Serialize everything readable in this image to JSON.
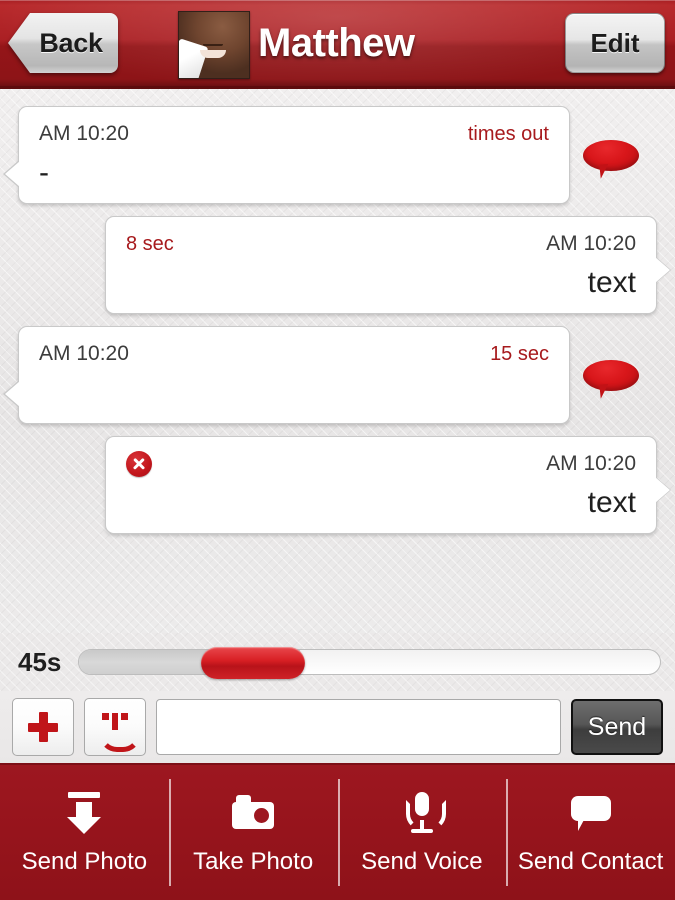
{
  "header": {
    "back_label": "Back",
    "title": "Matthew",
    "edit_label": "Edit",
    "avatar_name": "contact-avatar"
  },
  "colors": {
    "brand_red": "#9d1720",
    "header_red": "#a81f23",
    "status_red": "#a71a1d",
    "accent_red": "#c01519"
  },
  "conversation": {
    "messages": [
      {
        "direction": "incoming",
        "time": "AM 10:20",
        "status": "times out",
        "body": "-",
        "has_error": false,
        "has_speech_icon": true
      },
      {
        "direction": "outgoing",
        "time": "AM 10:20",
        "status": "8 sec",
        "body": "text",
        "has_error": false,
        "has_speech_icon": false
      },
      {
        "direction": "incoming",
        "time": "AM 10:20",
        "status": "15 sec",
        "body": "",
        "has_error": false,
        "has_speech_icon": true
      },
      {
        "direction": "outgoing",
        "time": "AM 10:20",
        "status": "",
        "body": "text",
        "has_error": true,
        "has_speech_icon": false
      }
    ]
  },
  "slider": {
    "label": "45s",
    "value": 45,
    "min": 0,
    "max": 180,
    "fill_percent": 38,
    "thumb_percent": 21
  },
  "composer": {
    "attach_icon": "plus-icon",
    "emoji_icon": "smiley-icon",
    "input_value": "",
    "input_placeholder": "",
    "send_label": "Send"
  },
  "toolbar": {
    "items": [
      {
        "label": "Send Photo",
        "icon": "download-arrow-icon"
      },
      {
        "label": "Take Photo",
        "icon": "camera-icon"
      },
      {
        "label": "Send Voice",
        "icon": "microphone-icon"
      },
      {
        "label": "Send Contact",
        "icon": "chat-bubble-icon"
      }
    ]
  }
}
